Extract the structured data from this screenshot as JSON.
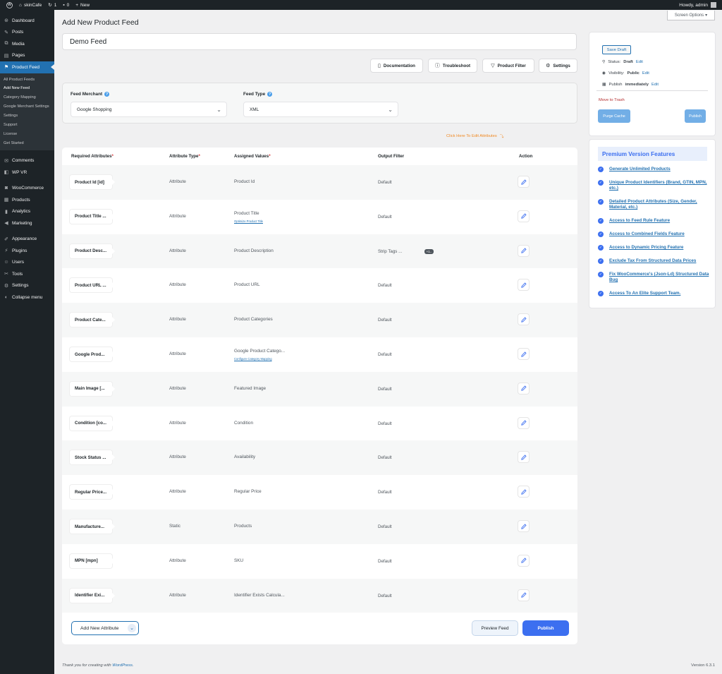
{
  "adminbar": {
    "site_name": "skinCafe",
    "updates_count": "1",
    "comments_count": "0",
    "new_label": "New",
    "howdy": "Howdy, admin"
  },
  "sidebar": {
    "items_top": [
      {
        "label": "Dashboard",
        "icon": "dashboard-icon",
        "glyph": "⊛"
      },
      {
        "label": "Posts",
        "icon": "pin-icon",
        "glyph": "✎"
      },
      {
        "label": "Media",
        "icon": "media-icon",
        "glyph": "⧉"
      },
      {
        "label": "Pages",
        "icon": "pages-icon",
        "glyph": "▤"
      },
      {
        "label": "Product Feed",
        "icon": "feed-icon",
        "glyph": "⚑"
      }
    ],
    "submenu": [
      "All Product Feeds",
      "Add New Feed",
      "Category Mapping",
      "Google Merchant Settings",
      "Settings",
      "Support",
      "License",
      "Get Started"
    ],
    "items_mid": [
      {
        "label": "Comments",
        "icon": "comments-icon",
        "glyph": "✉"
      },
      {
        "label": "WP VR",
        "icon": "vr-icon",
        "glyph": "◧"
      }
    ],
    "items_bottom": [
      {
        "label": "WooCommerce",
        "icon": "woo-icon",
        "glyph": "◙"
      },
      {
        "label": "Products",
        "icon": "products-icon",
        "glyph": "▦"
      },
      {
        "label": "Analytics",
        "icon": "analytics-icon",
        "glyph": "▮"
      },
      {
        "label": "Marketing",
        "icon": "marketing-icon",
        "glyph": "◀"
      }
    ],
    "items_admin": [
      {
        "label": "Appearance",
        "icon": "brush-icon",
        "glyph": "✐"
      },
      {
        "label": "Plugins",
        "icon": "plugin-icon",
        "glyph": "⚡"
      },
      {
        "label": "Users",
        "icon": "users-icon",
        "glyph": "☺"
      },
      {
        "label": "Tools",
        "icon": "tools-icon",
        "glyph": "✂"
      },
      {
        "label": "Settings",
        "icon": "settings-icon",
        "glyph": "⚙"
      },
      {
        "label": "Collapse menu",
        "icon": "collapse-icon",
        "glyph": "◐"
      }
    ]
  },
  "header": {
    "title": "Add New Product Feed",
    "screen_options": "Screen Options"
  },
  "feed_title": "Demo Feed",
  "toolbar": {
    "documentation": "Documentation",
    "troubleshoot": "Troubleshoot",
    "product_filter": "Product Filter",
    "settings": "Settings"
  },
  "merchant": {
    "merchant_label": "Feed Merchant",
    "merchant_value": "Google Shopping",
    "type_label": "Feed Type",
    "type_value": "XML"
  },
  "edit_hint": "Click Here To Edit Attributes",
  "table": {
    "headers": {
      "required": "Required Attributes",
      "type": "Attribute Type",
      "values": "Assigned Values",
      "filter": "Output Filter",
      "action": "Action"
    },
    "rows": [
      {
        "attr": "Product Id [id]",
        "type": "Attribute",
        "value": "Product Id",
        "link": "",
        "filter": "Default",
        "badge": ""
      },
      {
        "attr": "Product Title ...",
        "type": "Attribute",
        "value": "Product Title",
        "link": "Optimize Product Title",
        "filter": "Default",
        "badge": ""
      },
      {
        "attr": "Product Desc...",
        "type": "Attribute",
        "value": "Product Description",
        "link": "",
        "filter": "Strip Tags ...",
        "badge": "+1.."
      },
      {
        "attr": "Product URL ...",
        "type": "Attribute",
        "value": "Product URL",
        "link": "",
        "filter": "Default",
        "badge": ""
      },
      {
        "attr": "Product Cate...",
        "type": "Attribute",
        "value": "Product Categories",
        "link": "",
        "filter": "Default",
        "badge": ""
      },
      {
        "attr": "Google Prod...",
        "type": "Attribute",
        "value": "Google Product Catego...",
        "link": "Configure Category Mapping",
        "filter": "Default",
        "badge": ""
      },
      {
        "attr": "Main Image [...",
        "type": "Attribute",
        "value": "Featured Image",
        "link": "",
        "filter": "Default",
        "badge": ""
      },
      {
        "attr": "Condition [co...",
        "type": "Attribute",
        "value": "Condition",
        "link": "",
        "filter": "Default",
        "badge": ""
      },
      {
        "attr": "Stock Status ...",
        "type": "Attribute",
        "value": "Availability",
        "link": "",
        "filter": "Default",
        "badge": ""
      },
      {
        "attr": "Regular Price...",
        "type": "Attribute",
        "value": "Regular Price",
        "link": "",
        "filter": "Default",
        "badge": ""
      },
      {
        "attr": "Manufacture...",
        "type": "Static",
        "value": "Products",
        "link": "",
        "filter": "Default",
        "badge": ""
      },
      {
        "attr": "MPN [mpn]",
        "type": "Attribute",
        "value": "SKU",
        "link": "",
        "filter": "Default",
        "badge": ""
      },
      {
        "attr": "Identifier Exi...",
        "type": "Attribute",
        "value": "Identifier Exists Calcula...",
        "link": "",
        "filter": "Default",
        "badge": ""
      }
    ]
  },
  "actions": {
    "add_attribute": "Add New Attribute",
    "preview": "Preview Feed",
    "publish": "Publish"
  },
  "publish_box": {
    "save_draft": "Save Draft",
    "status_label": "Status:",
    "status_value": "Draft",
    "visibility_label": "Visibility:",
    "visibility_value": "Public",
    "publish_label": "Publish",
    "publish_value": "immediately",
    "edit": "Edit",
    "trash": "Move to Trash",
    "purge": "Purge Cache",
    "publish": "Publish"
  },
  "premium": {
    "title": "Premium Version Features",
    "features": [
      "Generate Unlimited Products",
      "Unique Product Identifiers (Brand, GTIN, MPN, etc.)",
      "Detailed Product Attributes (Size, Gender, Material, etc.)",
      "Access to Feed Rule Feature",
      "Access to Combined Fields Feature",
      "Access to Dynamic Pricing Feature",
      "Exclude Tax From Structured Data Prices",
      "Fix WooCommerce's (Json-Ld) Structured Data Bug",
      "Access To An Elite Support Team."
    ]
  },
  "footer": {
    "thanks": "Thank you for creating with",
    "wp": "WordPress",
    "version": "Version 6.3.1"
  },
  "colors": {
    "accent": "#2271b1",
    "publish_blue": "#3c6ff0",
    "sidebar_bg": "#1d2327",
    "hint_orange": "#f08a24"
  }
}
